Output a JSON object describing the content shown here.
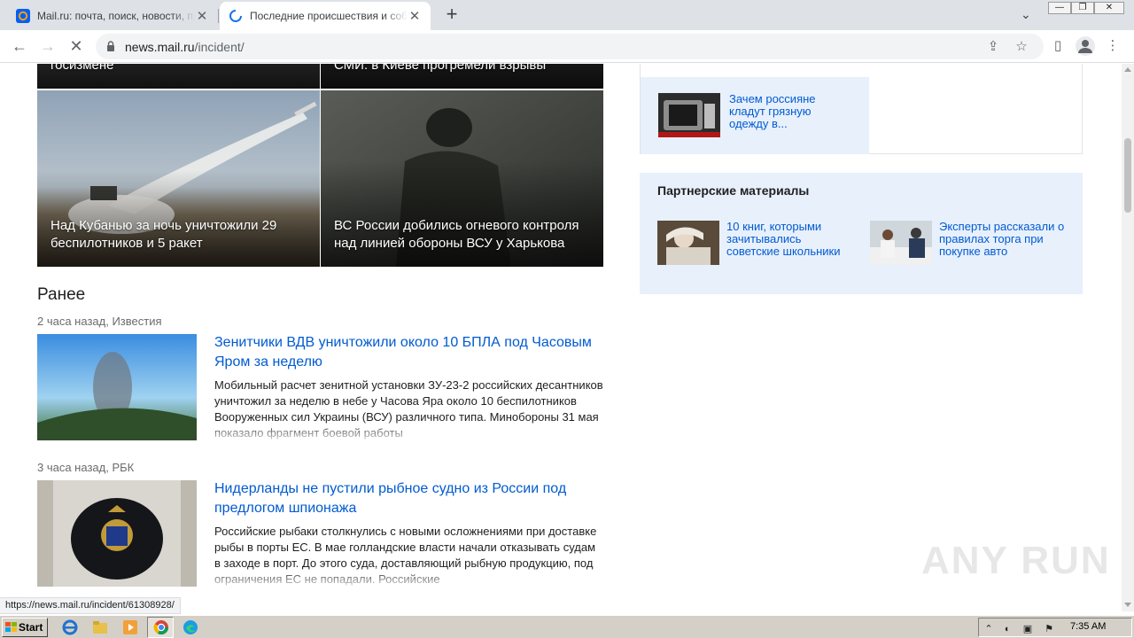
{
  "browser": {
    "tabs": [
      {
        "title": "Mail.ru: почта, поиск, новости, прогноз погоды, гороскоп",
        "active": false
      },
      {
        "title": "Последние происшествия и события",
        "active": true
      }
    ],
    "url_host": "news.mail.ru",
    "url_path": "/incident/",
    "status_url": "https://news.mail.ru/incident/61308928/"
  },
  "top_tiles": [
    {
      "caption": "госизмене"
    },
    {
      "caption": "СМИ: в Киеве прогремели взрывы"
    },
    {
      "caption": "Над Кубанью за ночь уничтожили 29 беспилотников и 5 ракет"
    },
    {
      "caption": "ВС России добились огневого контроля над линией обороны ВСУ у Харькова"
    }
  ],
  "earlier": {
    "heading": "Ранее",
    "items": [
      {
        "meta": "2 часа назад, Известия",
        "title": "Зенитчики ВДВ уничтожили около 10 БПЛА под Часовым Яром за неделю",
        "body": "Мобильный расчет зенитной установки ЗУ-23-2 российских десантников уничтожил за неделю в небе у Часова Яра около 10 беспилотников Вооруженных сил Украины (ВСУ) различного типа. Минобороны 31 мая показало фрагмент боевой работы"
      },
      {
        "meta": "3 часа назад, РБК",
        "title": "Нидерланды не пустили рыбное судно из России под предлогом шпионажа",
        "body": "Российские рыбаки столкнулись с новыми осложнениями при доставке рыбы в порты ЕС. В мае голландские власти начали отказывать судам в заходе в порт. До этого суда, доставляющий рыбную продукцию, под ограничения ЕС не попадали. Российские"
      }
    ]
  },
  "sidebar": {
    "card_item": {
      "text": "Зачем россияне кладут грязную одежду в..."
    },
    "partners": {
      "heading": "Партнерские материалы",
      "items": [
        {
          "text": "10 книг, которыми зачитывались советские школьники"
        },
        {
          "text": "Эксперты рассказали о правилах торга при покупке авто"
        }
      ]
    }
  },
  "watermark": "ANY RUN",
  "taskbar": {
    "start_label": "Start",
    "clock": "7:35 AM"
  },
  "colors": {
    "link": "#005bd1",
    "partner_bg": "#e8f0fc"
  }
}
